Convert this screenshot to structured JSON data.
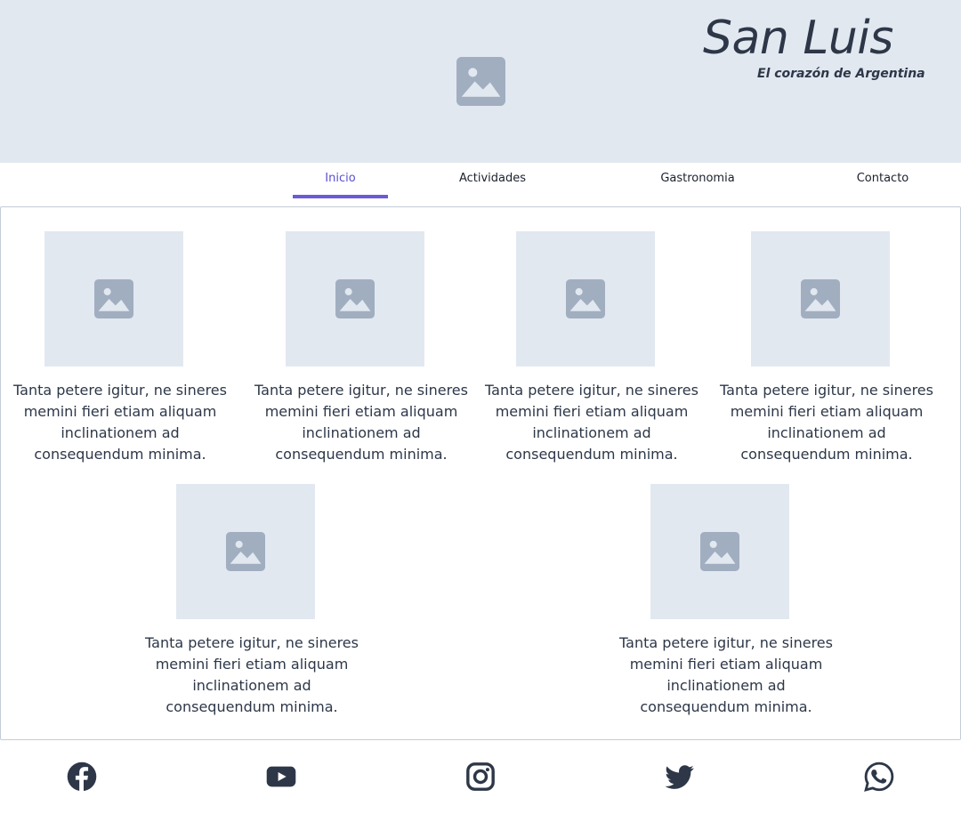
{
  "brand": {
    "title": "San Luis",
    "subtitle": "El corazón de Argentina"
  },
  "hero": {
    "image_icon": "image-placeholder-icon"
  },
  "nav": {
    "items": [
      {
        "label": "Inicio",
        "active": true
      },
      {
        "label": "Actividades",
        "active": false
      },
      {
        "label": "Gastronomia",
        "active": false
      },
      {
        "label": "Contacto",
        "active": false
      }
    ]
  },
  "cards": [
    {
      "image_icon": "image-placeholder-icon",
      "text": "Tanta petere igitur, ne sineres memini fieri etiam aliquam inclinationem ad consequendum minima."
    },
    {
      "image_icon": "image-placeholder-icon",
      "text": "Tanta petere igitur, ne sineres memini fieri etiam aliquam inclinationem ad consequendum minima."
    },
    {
      "image_icon": "image-placeholder-icon",
      "text": "Tanta petere igitur, ne sineres memini fieri etiam aliquam inclinationem ad consequendum minima."
    },
    {
      "image_icon": "image-placeholder-icon",
      "text": "Tanta petere igitur, ne sineres memini fieri etiam aliquam inclinationem ad consequendum minima."
    },
    {
      "image_icon": "image-placeholder-icon",
      "text": "Tanta petere igitur, ne sineres memini fieri etiam aliquam inclinationem ad consequendum minima."
    },
    {
      "image_icon": "image-placeholder-icon",
      "text": "Tanta petere igitur, ne sineres memini fieri etiam aliquam inclinationem ad consequendum minima."
    }
  ],
  "footer": {
    "social": [
      "facebook-icon",
      "youtube-icon",
      "instagram-icon",
      "twitter-icon",
      "whatsapp-icon"
    ]
  },
  "colors": {
    "placeholder_bg": "#e2e8f0",
    "placeholder_icon": "#a0aec0",
    "accent": "#6b5bd6",
    "text": "#2d3748"
  }
}
